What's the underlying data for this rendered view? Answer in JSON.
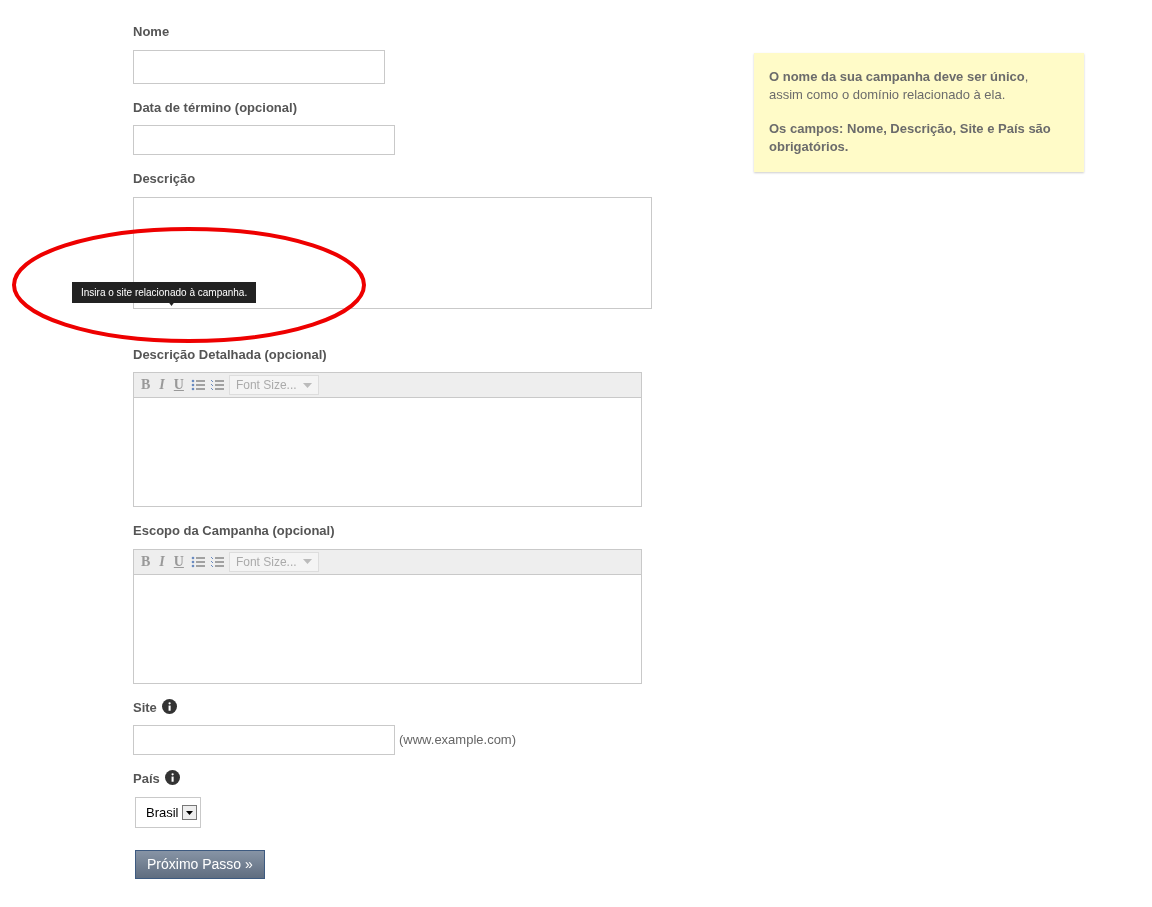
{
  "fields": [
    {
      "kind": "text",
      "label": "Nome"
    },
    {
      "kind": "text",
      "label": "Data de término (opcional)"
    },
    {
      "kind": "textarea",
      "label": "Descrição"
    },
    {
      "kind": "richtext",
      "label": "Descrição Detalhada (opcional)",
      "toolbar": [
        "B",
        "I",
        "U"
      ],
      "font_size_placeholder": "Font Size..."
    },
    {
      "kind": "richtext",
      "label": "Escopo da Campanha (opcional)",
      "toolbar": [
        "B",
        "I",
        "U"
      ],
      "font_size_placeholder": "Font Size..."
    },
    {
      "kind": "text",
      "label": "Site",
      "info": true,
      "hint": "(www.example.com)"
    },
    {
      "kind": "select",
      "label": "País",
      "info": true,
      "value": "Brasil"
    }
  ],
  "tooltip": "Insira o site relacionado à campanha.",
  "submit": "Próximo Passo »",
  "note": {
    "line_1": "**O nome da sua campanha deve ser único**,",
    "line_2": "assim como o domínio relacionado à ela.",
    "line_3": "Os campos: Nome, Descrição, Site e País são obrigatórios."
  }
}
